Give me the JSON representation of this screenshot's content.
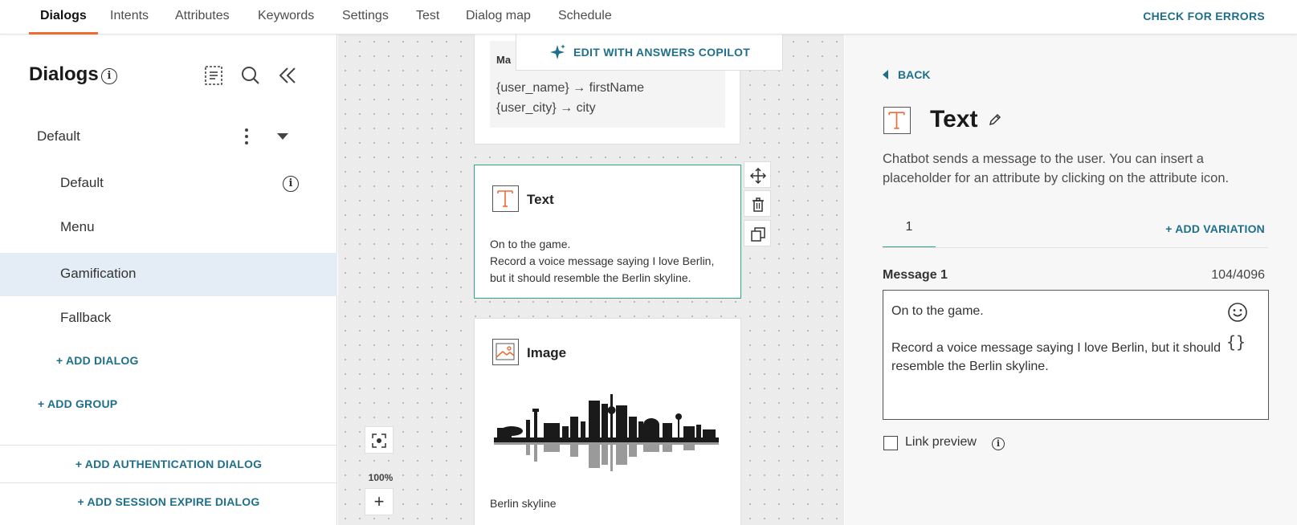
{
  "nav": {
    "tabs": [
      "Dialogs",
      "Intents",
      "Attributes",
      "Keywords",
      "Settings",
      "Test",
      "Dialog map",
      "Schedule"
    ],
    "active_tab": "Dialogs",
    "check_errors": "CHECK FOR ERRORS"
  },
  "sidebar": {
    "title": "Dialogs",
    "group": "Default",
    "items": [
      {
        "label": "Default",
        "has_info": true
      },
      {
        "label": "Menu"
      },
      {
        "label": "Gamification",
        "selected": true
      },
      {
        "label": "Fallback"
      }
    ],
    "add_dialog": "+ ADD DIALOG",
    "add_group": "+ ADD GROUP",
    "add_auth": "+ ADD AUTHENTICATION DIALOG",
    "add_session": "+ ADD SESSION EXPIRE DIALOG"
  },
  "canvas": {
    "copilot": "EDIT WITH ANSWERS COPILOT",
    "map_card": {
      "title_fragment": "Ma",
      "lines": [
        "{user_name} → firstName",
        "{user_city} → city"
      ]
    },
    "text_node": {
      "title": "Text",
      "lines": [
        "On to the game.",
        "Record a voice message saying I love Berlin,",
        "but it should resemble the Berlin skyline."
      ]
    },
    "image_node": {
      "title": "Image",
      "caption": "Berlin skyline"
    },
    "zoom": "100%",
    "zoom_in": "+"
  },
  "panel": {
    "back": "BACK",
    "title": "Text",
    "description": "Chatbot sends a message to the user. You can insert a placeholder for an attribute by clicking on the attribute icon.",
    "variation_tab": "1",
    "add_variation": "+ ADD VARIATION",
    "message_label": "Message 1",
    "message_count": "104/4096",
    "message_text": "On to the game.\n\nRecord a voice message saying I love Berlin, but it should resemble the Berlin skyline.",
    "braces": "{}",
    "link_preview": "Link preview"
  },
  "colors": {
    "accent_orange": "#f06a35",
    "link_teal": "#1f6f8b",
    "selection_green": "#2aa88a",
    "selected_row": "#e4edf5"
  }
}
